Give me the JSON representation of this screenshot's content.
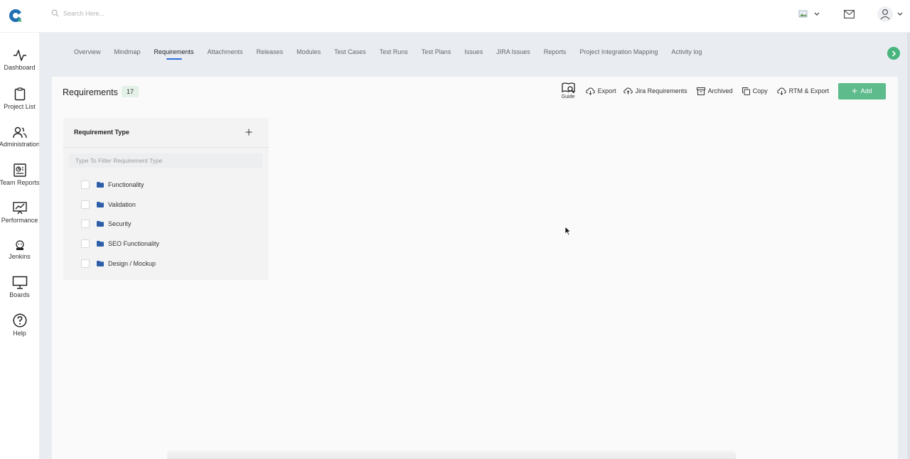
{
  "search": {
    "placeholder": "Search Here..."
  },
  "sidebar": {
    "items": [
      {
        "label": "Dashboard",
        "icon": "activity-icon"
      },
      {
        "label": "Project List",
        "icon": "clipboard-icon"
      },
      {
        "label": "Administration",
        "icon": "users-icon"
      },
      {
        "label": "Team Reports",
        "icon": "report-icon"
      },
      {
        "label": "Performance",
        "icon": "performance-icon"
      },
      {
        "label": "Jenkins",
        "icon": "jenkins-icon"
      },
      {
        "label": "Boards",
        "icon": "board-icon"
      },
      {
        "label": "Help",
        "icon": "help-icon"
      }
    ]
  },
  "tabs": [
    {
      "label": "Overview"
    },
    {
      "label": "Mindmap"
    },
    {
      "label": "Requirements",
      "active": true
    },
    {
      "label": "Attachments"
    },
    {
      "label": "Releases"
    },
    {
      "label": "Modules"
    },
    {
      "label": "Test Cases"
    },
    {
      "label": "Test Runs"
    },
    {
      "label": "Test Plans"
    },
    {
      "label": "Issues"
    },
    {
      "label": "JIRA Issues"
    },
    {
      "label": "Reports"
    },
    {
      "label": "Project Integration Mapping"
    },
    {
      "label": "Activity log"
    }
  ],
  "page": {
    "title": "Requirements",
    "count": "17"
  },
  "toolbar": {
    "guide_label": "Guide",
    "export_label": "Export",
    "jira_label": "Jira Requirements",
    "archived_label": "Archived",
    "copy_label": "Copy",
    "rtm_label": "RTM & Export",
    "add_label": "Add"
  },
  "req_types": {
    "title": "Requirement Type",
    "filter_placeholder": "Type To Filter Requirement Type",
    "items": [
      {
        "label": "Functionality"
      },
      {
        "label": "Validation"
      },
      {
        "label": "Security"
      },
      {
        "label": "SEO Functionality"
      },
      {
        "label": "Design / Mockup"
      }
    ]
  },
  "colors": {
    "accent": "#5dbb8c",
    "tab_active": "#2d6ad8",
    "folder": "#2d5fa8"
  }
}
